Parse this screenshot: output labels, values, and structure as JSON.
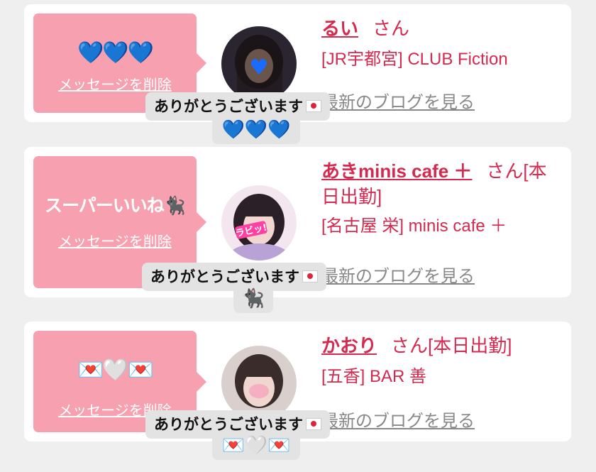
{
  "cards": [
    {
      "message": "💙💙💙",
      "delete_label": "メッセージを削除",
      "name": "るい",
      "honorific": "さん",
      "shop": "[JR宇都宮] CLUB Fiction",
      "blog_label": "最新のブログを見る",
      "reply_text": "ありがとうございます",
      "reply_emoji": "💙💙💙"
    },
    {
      "message": "スーパーいいね🐈‍⬛",
      "delete_label": "メッセージを削除",
      "name": "あきminis cafe ＋",
      "honorific": "さん[本日出勤]",
      "shop": "[名古屋 栄] minis cafe ＋",
      "blog_label": "最新のブログを見る",
      "reply_text": "ありがとうございます",
      "reply_emoji": "🐈‍⬛"
    },
    {
      "message": "💌🤍💌",
      "delete_label": "メッセージを削除",
      "name": "かおり",
      "honorific": "さん[本日出勤]",
      "shop": "[五香] BAR 善",
      "blog_label": "最新のブログを見る",
      "reply_text": "ありがとうございます",
      "reply_emoji": "💌🤍💌"
    }
  ],
  "icons": {
    "envelope": "love-letter-icon"
  },
  "colors": {
    "accent": "#d6294f",
    "message_bg": "#f7a0b0",
    "page_bg": "#efefef"
  }
}
